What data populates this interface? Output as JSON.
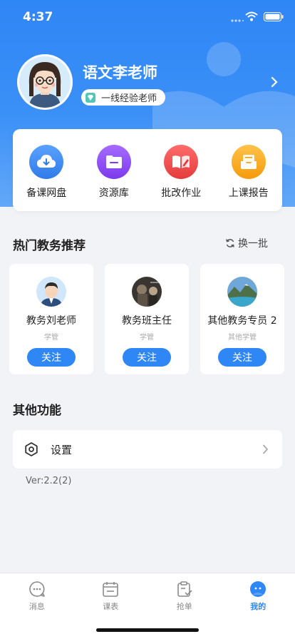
{
  "status_bar": {
    "time": "4:37"
  },
  "profile": {
    "name": "语文李老师",
    "role": "一线经验老师"
  },
  "quick_actions": [
    {
      "label": "备课网盘",
      "icon": "cloud-download-icon",
      "color": "#3b82f6"
    },
    {
      "label": "资源库",
      "icon": "folder-icon",
      "color": "#8b5cf6"
    },
    {
      "label": "批改作业",
      "icon": "book-pen-icon",
      "color": "#f04e4e"
    },
    {
      "label": "上课报告",
      "icon": "inbox-tray-icon",
      "color": "#f5a623"
    }
  ],
  "recommend": {
    "title": "热门教务推荐",
    "refresh_label": "换一批",
    "items": [
      {
        "name": "教务刘老师",
        "sub": "学管",
        "button": "关注"
      },
      {
        "name": "教务班主任",
        "sub": "学管",
        "button": "关注"
      },
      {
        "name": "其他教务专员 2",
        "sub": "其他学管",
        "button": "关注"
      }
    ]
  },
  "other": {
    "title": "其他功能",
    "settings_label": "设置",
    "version": "Ver:2.2(2)"
  },
  "tabs": [
    {
      "label": "消息",
      "icon": "chat-bubble-icon"
    },
    {
      "label": "课表",
      "icon": "calendar-icon"
    },
    {
      "label": "抢单",
      "icon": "clipboard-check-icon"
    },
    {
      "label": "我的",
      "icon": "user-icon",
      "active": true
    }
  ],
  "colors": {
    "primary": "#2f86f5",
    "background": "#f2f3f7"
  }
}
